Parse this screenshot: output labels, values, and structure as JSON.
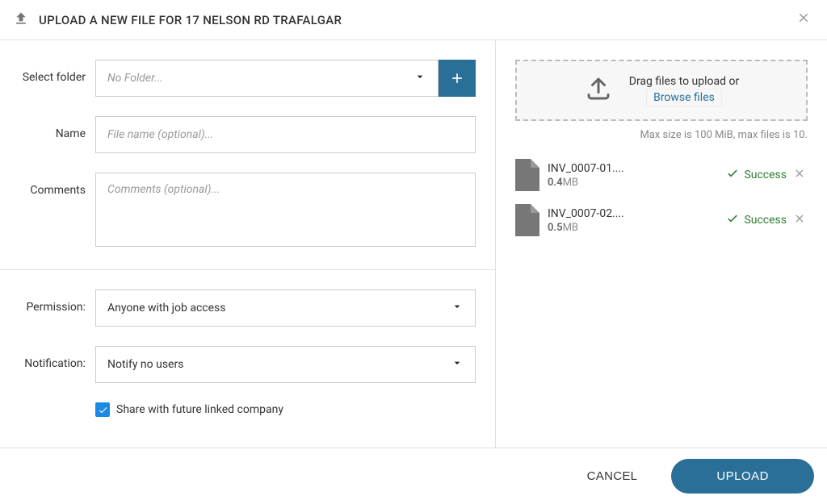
{
  "header": {
    "title": "UPLOAD A NEW FILE FOR 17 NELSON RD TRAFALGAR"
  },
  "form": {
    "folder": {
      "label": "Select folder",
      "placeholder": "No Folder..."
    },
    "name": {
      "label": "Name",
      "placeholder": "File name (optional)..."
    },
    "comments": {
      "label": "Comments",
      "placeholder": "Comments (optional)..."
    },
    "permission": {
      "label": "Permission:",
      "value": "Anyone with job access"
    },
    "notification": {
      "label": "Notification:",
      "value": "Notify no users"
    },
    "share_future": {
      "checked": true,
      "label": "Share with future linked company"
    }
  },
  "dropzone": {
    "drag_text": "Drag files to upload or",
    "browse_text": "Browse files",
    "limits": "Max size is 100 MiB, max files is 10."
  },
  "files": [
    {
      "name": "INV_0007-01....",
      "size_num": "0.4",
      "size_unit": "MB",
      "status": "Success"
    },
    {
      "name": "INV_0007-02....",
      "size_num": "0.5",
      "size_unit": "MB",
      "status": "Success"
    }
  ],
  "footer": {
    "cancel": "CANCEL",
    "upload": "UPLOAD"
  }
}
